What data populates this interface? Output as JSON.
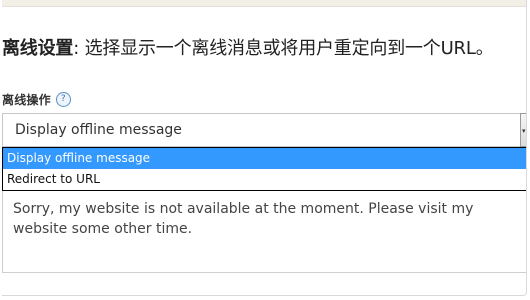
{
  "section": {
    "heading_bold": "离线设置",
    "heading_rest": ": 选择显示一个离线消息或将用户重定向到一个URL。"
  },
  "field": {
    "label": "离线操作",
    "help_icon": "question-mark-icon",
    "help_glyph": "?"
  },
  "select": {
    "selected_value": "Display offline message",
    "arrow_glyph": "▾",
    "options": [
      {
        "label": "Display offline message",
        "highlighted": true
      },
      {
        "label": "Redirect to URL",
        "highlighted": false
      }
    ]
  },
  "message": {
    "value": "Sorry, my website is not available at the moment. Please visit my website some other time."
  },
  "colors": {
    "highlight": "#3399ff",
    "top_strip": "#f2efe7"
  }
}
